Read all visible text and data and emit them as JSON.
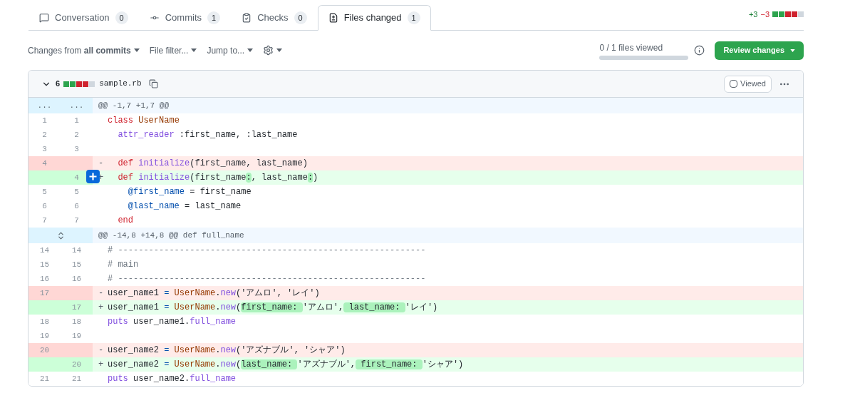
{
  "tabs": [
    {
      "label": "Conversation",
      "count": "0",
      "selected": false
    },
    {
      "label": "Commits",
      "count": "1",
      "selected": false
    },
    {
      "label": "Checks",
      "count": "0",
      "selected": false
    },
    {
      "label": "Files changed",
      "count": "1",
      "selected": true
    }
  ],
  "diffstat": {
    "additions": "+3",
    "deletions": "−3",
    "blocks": [
      {
        "color": "#2da44e"
      },
      {
        "color": "#2da44e"
      },
      {
        "color": "#cf222e"
      },
      {
        "color": "#cf222e"
      },
      {
        "color": "#d0d7de"
      }
    ]
  },
  "toolbar": {
    "changes_from": "Changes from **all commits**",
    "file_filter": "File filter...",
    "jump_to": "Jump to...",
    "files_viewed": "0 / 1 files viewed",
    "progress": {
      "level": 0
    },
    "review_button": "Review changes"
  },
  "file": {
    "expanded": true,
    "changes": "6",
    "blocks": [
      {
        "color": "#2da44e"
      },
      {
        "color": "#2da44e"
      },
      {
        "color": "#cf222e"
      },
      {
        "color": "#cf222e"
      },
      {
        "color": "#d0d7de"
      }
    ],
    "name": "sample.rb",
    "viewed": false,
    "viewed_label": "Viewed",
    "rows": [
      {
        "kind": "hunk",
        "old": "...",
        "new": "...",
        "text": "@@ -1,7 +1,7 @@"
      },
      {
        "kind": "context",
        "old": "1",
        "new": "1",
        "tokens": [
          {
            "text": "class ",
            "kind": "keyword"
          },
          {
            "text": "UserName",
            "kind": "constant"
          }
        ]
      },
      {
        "kind": "context",
        "old": "2",
        "new": "2",
        "tokens": [
          {
            "text": "  attr_reader",
            "kind": "method"
          },
          {
            "text": " :first_name, :last_name",
            "kind": "plain"
          }
        ]
      },
      {
        "kind": "context",
        "old": "3",
        "new": "3",
        "tokens": []
      },
      {
        "kind": "del",
        "old": "4",
        "sign": "-",
        "tokens": [
          {
            "text": "  def ",
            "kind": "keyword"
          },
          {
            "text": "initialize",
            "kind": "method"
          },
          {
            "text": "(first_name, last_name)",
            "kind": "plain"
          }
        ]
      },
      {
        "kind": "add",
        "new": "4",
        "sign": "+",
        "tokens": [
          {
            "text": "  def ",
            "kind": "keyword"
          },
          {
            "text": "initialize",
            "kind": "method"
          },
          {
            "text": "(first_name",
            "kind": "plain"
          },
          {
            "text": ":",
            "kind": "highlight"
          },
          {
            "text": ", last_name",
            "kind": "plain"
          },
          {
            "text": ":",
            "kind": "highlight"
          },
          {
            "text": ")",
            "kind": "plain"
          }
        ]
      },
      {
        "kind": "context",
        "old": "5",
        "new": "5",
        "tokens": [
          {
            "text": "    @first_name",
            "kind": "ivar"
          },
          {
            "text": " = first_name",
            "kind": "plain"
          }
        ]
      },
      {
        "kind": "context",
        "old": "6",
        "new": "6",
        "tokens": [
          {
            "text": "    @last_name",
            "kind": "ivar"
          },
          {
            "text": " = last_name",
            "kind": "plain"
          }
        ]
      },
      {
        "kind": "context",
        "old": "7",
        "new": "7",
        "tokens": [
          {
            "text": "  end",
            "kind": "keyword"
          }
        ]
      },
      {
        "kind": "hunk",
        "text": "@@ -14,8 +14,8 @@ def full_name"
      },
      {
        "kind": "context",
        "old": "14",
        "new": "14",
        "tokens": [
          {
            "text": "# ------------------------------------------------------------",
            "kind": "comment"
          }
        ]
      },
      {
        "kind": "context",
        "old": "15",
        "new": "15",
        "tokens": [
          {
            "text": "# main",
            "kind": "comment"
          }
        ]
      },
      {
        "kind": "context",
        "old": "16",
        "new": "16",
        "tokens": [
          {
            "text": "# ------------------------------------------------------------",
            "kind": "comment"
          }
        ]
      },
      {
        "kind": "del",
        "old": "17",
        "sign": "-",
        "tokens": [
          {
            "text": "user_name1 ",
            "kind": "plain"
          },
          {
            "text": "=",
            "kind": "ivar"
          },
          {
            "text": " UserName",
            "kind": "constant"
          },
          {
            "text": ".",
            "kind": "plain"
          },
          {
            "text": "new",
            "kind": "method"
          },
          {
            "text": "('アムロ', 'レイ')",
            "kind": "plain"
          }
        ]
      },
      {
        "kind": "add",
        "new": "17",
        "sign": "+",
        "tokens": [
          {
            "text": "user_name1 ",
            "kind": "plain"
          },
          {
            "text": "=",
            "kind": "ivar"
          },
          {
            "text": " UserName",
            "kind": "constant"
          },
          {
            "text": ".",
            "kind": "plain"
          },
          {
            "text": "new",
            "kind": "method"
          },
          {
            "text": "(",
            "kind": "plain"
          },
          {
            "text": "first_name: ",
            "kind": "highlight"
          },
          {
            "text": "'アムロ',",
            "kind": "plain"
          },
          {
            "text": " last_name: ",
            "kind": "highlight"
          },
          {
            "text": "'レイ')",
            "kind": "plain"
          }
        ]
      },
      {
        "kind": "context",
        "old": "18",
        "new": "18",
        "tokens": [
          {
            "text": "puts",
            "kind": "method"
          },
          {
            "text": " user_name1.",
            "kind": "plain"
          },
          {
            "text": "full_name",
            "kind": "method"
          }
        ]
      },
      {
        "kind": "context",
        "old": "19",
        "new": "19",
        "tokens": []
      },
      {
        "kind": "del",
        "old": "20",
        "sign": "-",
        "tokens": [
          {
            "text": "user_name2 ",
            "kind": "plain"
          },
          {
            "text": "=",
            "kind": "ivar"
          },
          {
            "text": " UserName",
            "kind": "constant"
          },
          {
            "text": ".",
            "kind": "plain"
          },
          {
            "text": "new",
            "kind": "method"
          },
          {
            "text": "('アズナブル', 'シャア')",
            "kind": "plain"
          }
        ]
      },
      {
        "kind": "add",
        "new": "20",
        "sign": "+",
        "tokens": [
          {
            "text": "user_name2 ",
            "kind": "plain"
          },
          {
            "text": "=",
            "kind": "ivar"
          },
          {
            "text": " UserName",
            "kind": "constant"
          },
          {
            "text": ".",
            "kind": "plain"
          },
          {
            "text": "new",
            "kind": "method"
          },
          {
            "text": "(",
            "kind": "plain"
          },
          {
            "text": "last_name: ",
            "kind": "highlight"
          },
          {
            "text": "'アズナブル',",
            "kind": "plain"
          },
          {
            "text": " first_name: ",
            "kind": "highlight"
          },
          {
            "text": "'シャア')",
            "kind": "plain"
          }
        ]
      },
      {
        "kind": "context",
        "old": "21",
        "new": "21",
        "tokens": [
          {
            "text": "puts",
            "kind": "method"
          },
          {
            "text": " user_name2.",
            "kind": "plain"
          },
          {
            "text": "full_name",
            "kind": "method"
          }
        ]
      }
    ]
  }
}
